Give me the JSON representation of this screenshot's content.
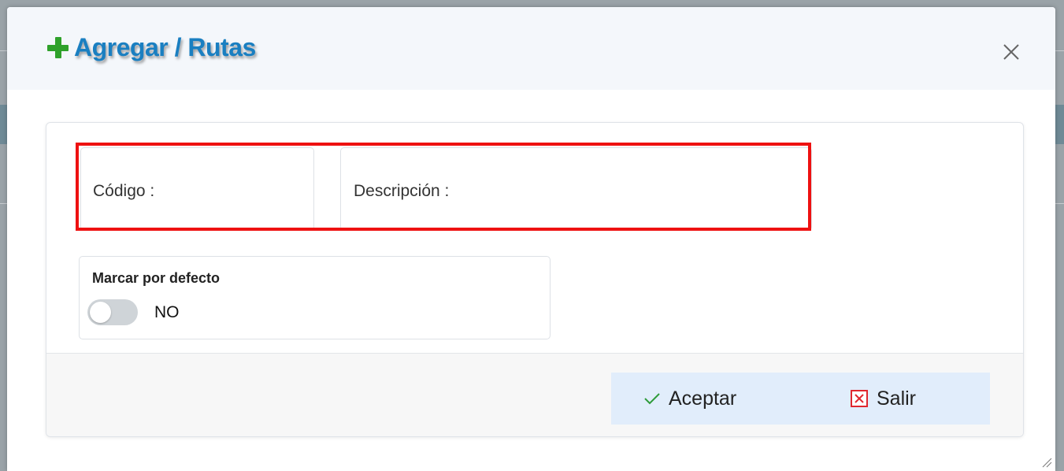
{
  "dialog": {
    "title": "Agregar / Rutas",
    "close_icon": "close-icon",
    "title_icon": "plus-icon",
    "title_color": "#1a7fc1",
    "icon_color": "#2fa12b"
  },
  "form": {
    "codigo_label": "Código :",
    "descripcion_label": "Descripción :",
    "highlight_color": "#ee1111"
  },
  "toggle": {
    "title": "Marcar por defecto",
    "state_label": "NO",
    "checked": false
  },
  "footer": {
    "accept_label": "Aceptar",
    "accept_icon": "check-icon",
    "exit_label": "Salir",
    "exit_icon": "close-box-icon",
    "button_group_bg": "#e1edfb"
  }
}
